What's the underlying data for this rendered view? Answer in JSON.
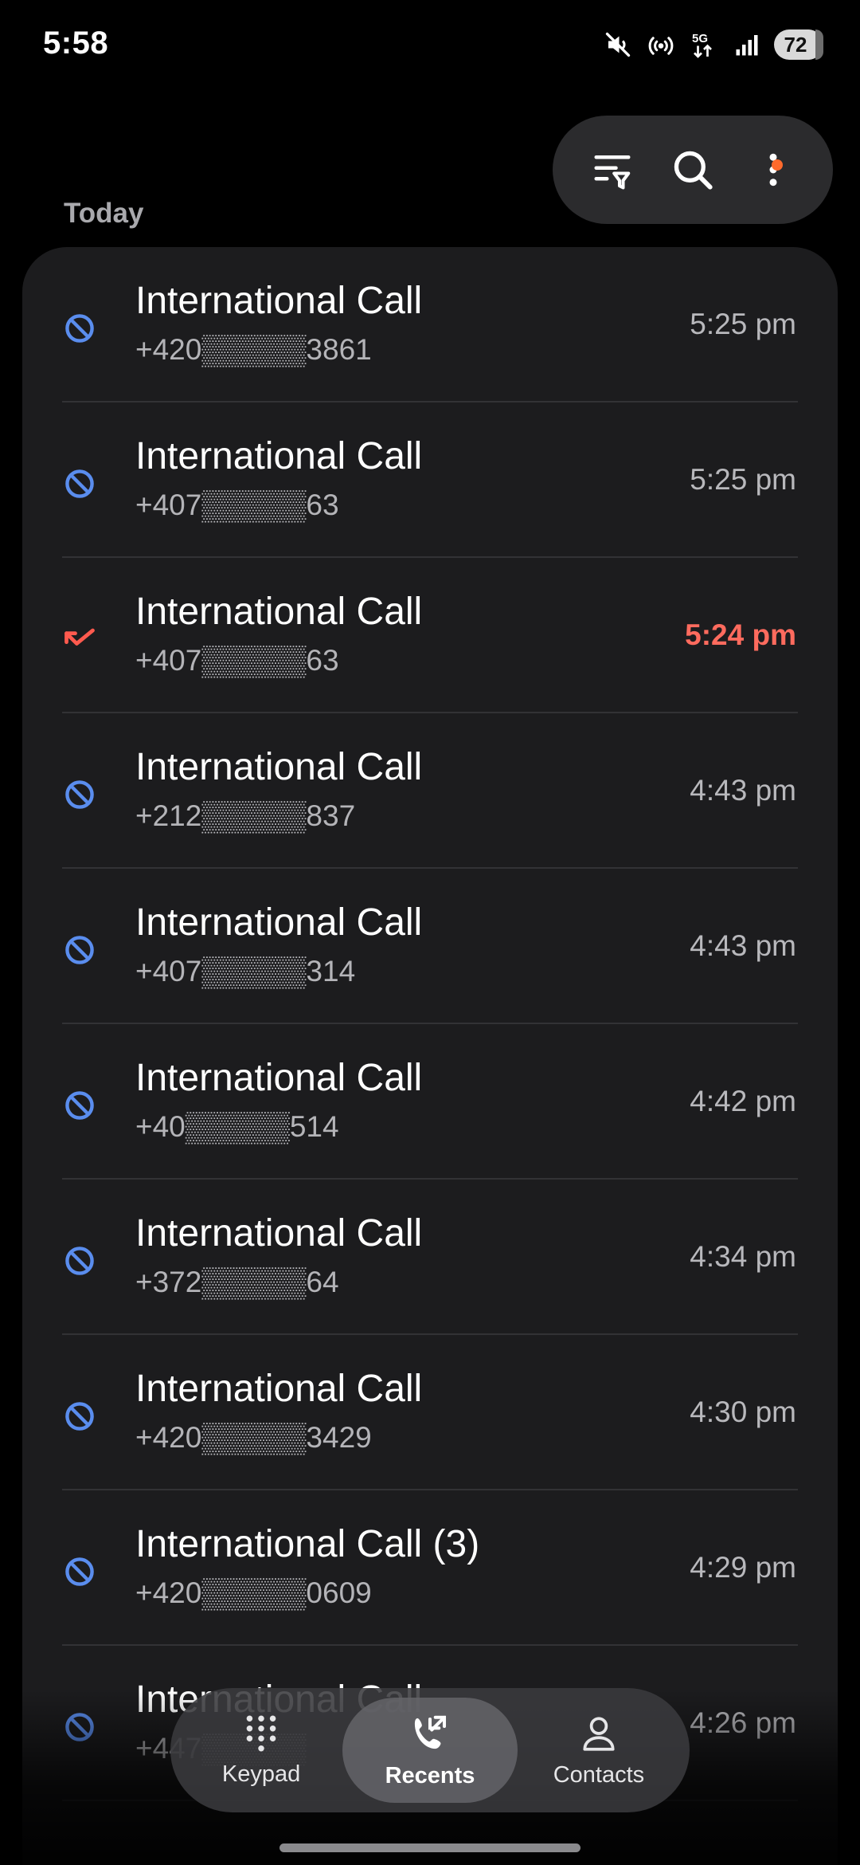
{
  "status_bar": {
    "time": "5:58",
    "battery": "72",
    "icons": [
      "mute-icon",
      "hotspot-icon",
      "5g-icon",
      "signal-icon",
      "battery-icon"
    ]
  },
  "toolbar": {
    "icons": [
      "filter-icon",
      "search-icon",
      "more-options-icon"
    ],
    "notification_dot_color": "#ff6a2c"
  },
  "section": {
    "label": "Today"
  },
  "calls": [
    {
      "name": "International Call",
      "number": "+420▒▒▒▒▒3861",
      "time": "5:25 pm",
      "type": "blocked"
    },
    {
      "name": "International Call",
      "number": "+407▒▒▒▒▒63",
      "time": "5:25 pm",
      "type": "blocked"
    },
    {
      "name": "International Call",
      "number": "+407▒▒▒▒▒63",
      "time": "5:24 pm",
      "type": "missed"
    },
    {
      "name": "International Call",
      "number": "+212▒▒▒▒▒837",
      "time": "4:43 pm",
      "type": "blocked"
    },
    {
      "name": "International Call",
      "number": "+407▒▒▒▒▒314",
      "time": "4:43 pm",
      "type": "blocked"
    },
    {
      "name": "International Call",
      "number": "+40▒▒▒▒▒514",
      "time": "4:42 pm",
      "type": "blocked"
    },
    {
      "name": "International Call",
      "number": "+372▒▒▒▒▒64",
      "time": "4:34 pm",
      "type": "blocked"
    },
    {
      "name": "International Call",
      "number": "+420▒▒▒▒▒3429",
      "time": "4:30 pm",
      "type": "blocked"
    },
    {
      "name": "International Call (3)",
      "number": "+420▒▒▒▒▒0609",
      "time": "4:29 pm",
      "type": "blocked"
    },
    {
      "name": "International Call",
      "number": "+447▒▒▒▒▒",
      "time": "4:26 pm",
      "type": "blocked"
    }
  ],
  "bottom_nav": {
    "items": [
      {
        "label": "Keypad",
        "icon": "keypad-icon",
        "active": false
      },
      {
        "label": "Recents",
        "icon": "recents-icon",
        "active": true
      },
      {
        "label": "Contacts",
        "icon": "contacts-icon",
        "active": false
      }
    ]
  },
  "colors": {
    "blocked_icon": "#5a8dee",
    "missed_icon": "#ff5a4e",
    "missed_time": "#ff6b5e",
    "card_bg": "#1c1c1e"
  }
}
